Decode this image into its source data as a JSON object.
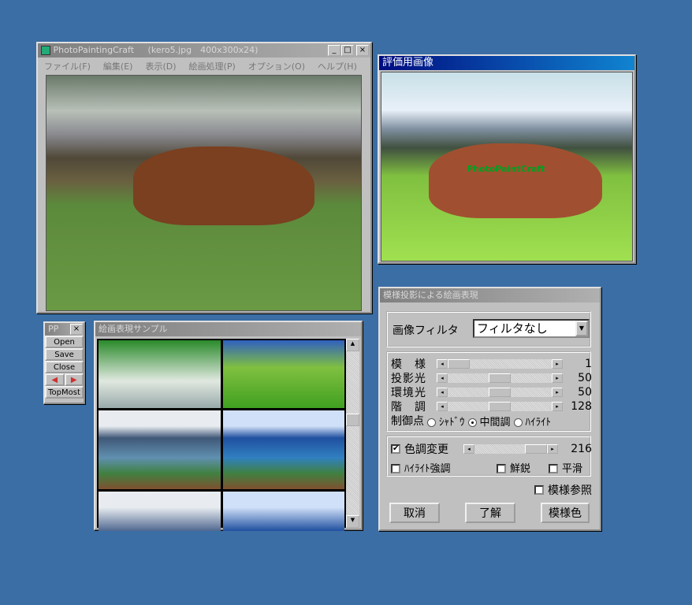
{
  "main_window": {
    "title": "PhotoPaintingCraft",
    "file_info": "(kero5.jpg　400x300x24)",
    "menu": [
      "ファイル(F)",
      "編集(E)",
      "表示(D)",
      "絵画処理(P)",
      "オプション(O)",
      "ヘルプ(H)"
    ],
    "controls": {
      "minimize": "_",
      "maximize": "□",
      "close": "×"
    }
  },
  "eval_window": {
    "title": "評価用画像",
    "watermark": "PhotoPaintCraft"
  },
  "pp_window": {
    "title": "PP",
    "close": "×",
    "buttons": [
      "Open",
      "Save",
      "Close"
    ],
    "prev": "◀",
    "next": "▶",
    "topmost": "TopMost"
  },
  "sample_window": {
    "title": "絵画表現サンプル"
  },
  "dialog": {
    "title": "模様投影による絵画表現",
    "filter_label": "画像フィルタ",
    "filter_value": "フィルタなし",
    "sliders": [
      {
        "label": "模　様",
        "value": 1,
        "fraction": 0.0
      },
      {
        "label": "投影光",
        "value": 50,
        "fraction": 0.5
      },
      {
        "label": "環境光",
        "value": 50,
        "fraction": 0.5
      },
      {
        "label": "階　調",
        "value": 128,
        "fraction": 0.5
      }
    ],
    "control_point_label": "制御点",
    "radios": [
      {
        "label": "ｼｬﾄﾞｳ",
        "checked": false
      },
      {
        "label": "中間調",
        "checked": true
      },
      {
        "label": "ﾊｲﾗｲﾄ",
        "checked": false
      }
    ],
    "tone_change": {
      "label": "色調変更",
      "checked": true,
      "value": 216,
      "fraction": 0.85
    },
    "checks": [
      {
        "label": "ﾊｲﾗｲﾄ強調",
        "checked": false
      },
      {
        "label": "鮮鋭",
        "checked": false
      },
      {
        "label": "平滑",
        "checked": false
      }
    ],
    "pattern_ref": {
      "label": "模様参照",
      "checked": false
    },
    "buttons": {
      "cancel": "取消",
      "ok": "了解",
      "pattern_color": "模様色"
    }
  },
  "colors": {
    "desktop": "#3a6ea5",
    "active_title": "#000c80"
  }
}
